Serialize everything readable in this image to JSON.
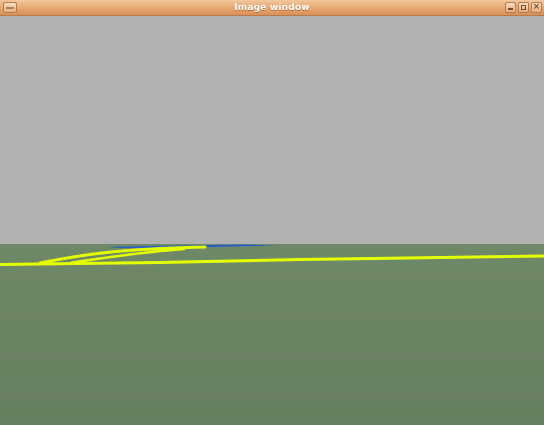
{
  "window": {
    "title": "Image window"
  },
  "colors": {
    "titlebar_accent": "#e6a66f",
    "sky": "#b1b1b1",
    "ground": "#6a8464",
    "lane_line": "#e4ff00",
    "far_line": "#1f5ccf"
  },
  "icons": {
    "window_menu": "window-menu-icon",
    "minimize": "minimize-icon",
    "maximize": "maximize-icon",
    "close": "close-icon"
  }
}
